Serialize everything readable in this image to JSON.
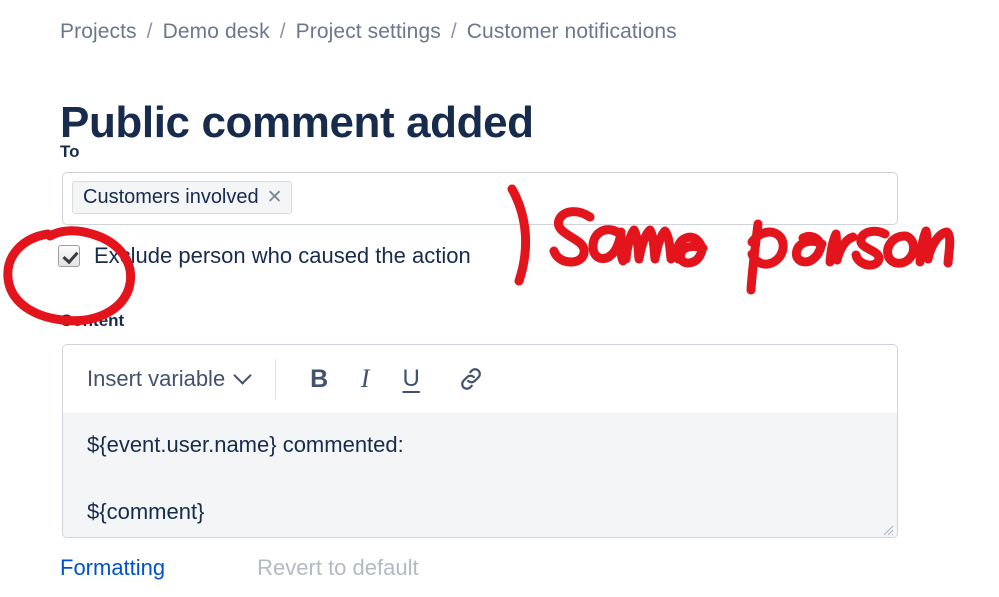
{
  "breadcrumb": {
    "separator": "/",
    "items": [
      {
        "label": "Projects"
      },
      {
        "label": "Demo desk"
      },
      {
        "label": "Project settings"
      },
      {
        "label": "Customer notifications"
      }
    ]
  },
  "page": {
    "title": "Public comment added"
  },
  "to_field": {
    "label": "To",
    "chips": [
      {
        "label": "Customers involved",
        "remove_icon": "close-icon",
        "remove_glyph": "✕"
      }
    ]
  },
  "exclude_option": {
    "label": "Exclude person who caused the action",
    "checked": true
  },
  "content": {
    "label": "Content",
    "toolbar": {
      "insert_variable_label": "Insert variable",
      "chevron_icon": "chevron-down-icon",
      "bold_label": "B",
      "italic_label": "I",
      "underline_label": "U",
      "link_icon": "link-icon"
    },
    "body_lines": [
      "${event.user.name} commented:",
      "${comment}"
    ],
    "resize_icon": "resize-grip-icon"
  },
  "footer": {
    "formatting_label": "Formatting",
    "revert_label": "Revert to default"
  },
  "annotation": {
    "text": "same person",
    "color": "#e3141c",
    "marks": [
      "ellipse-around-checkbox",
      "bracket-stroke",
      "handwritten-text"
    ]
  },
  "colors": {
    "title": "#172b4d",
    "breadcrumb": "#6b778c",
    "link": "#0052cc",
    "muted": "#b3bac5",
    "field_border": "#cfd4da",
    "editor_body_bg": "#f4f5f7",
    "annotation_red": "#e3141c"
  }
}
